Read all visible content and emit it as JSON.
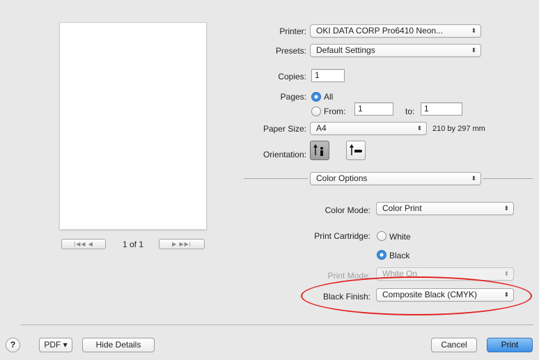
{
  "printer": {
    "label": "Printer:",
    "value": "OKI DATA CORP Pro6410 Neon..."
  },
  "presets": {
    "label": "Presets:",
    "value": "Default Settings"
  },
  "copies": {
    "label": "Copies:",
    "value": "1"
  },
  "pages": {
    "label": "Pages:",
    "all_label": "All",
    "from_label": "From:",
    "from_value": "1",
    "to_label": "to:",
    "to_value": "1",
    "selected": "All"
  },
  "paper_size": {
    "label": "Paper Size:",
    "value": "A4",
    "dimensions": "210 by 297 mm"
  },
  "orientation": {
    "label": "Orientation:",
    "selected": "portrait"
  },
  "section_popup": {
    "value": "Color Options"
  },
  "color_mode": {
    "label": "Color Mode:",
    "value": "Color Print"
  },
  "print_cartridge": {
    "label": "Print Cartridge:",
    "options": [
      "White",
      "Black"
    ],
    "selected": "Black"
  },
  "print_mode": {
    "label": "Print Mode:",
    "value": "White On"
  },
  "black_finish": {
    "label": "Black Finish:",
    "value": "Composite Black (CMYK)"
  },
  "pager": {
    "text": "1 of 1",
    "first": "|◀◀",
    "prev": "◀",
    "next": "▶",
    "last": "▶▶|"
  },
  "bottom": {
    "help": "?",
    "pdf": "PDF ▾",
    "hide_details": "Hide Details",
    "cancel": "Cancel",
    "print": "Print"
  },
  "colors": {
    "highlight_ellipse": "#e32222",
    "accent": "#3d8fe6"
  },
  "icons": [
    "help-icon",
    "popup-arrows-icon",
    "portrait-orientation-icon",
    "landscape-orientation-icon"
  ]
}
